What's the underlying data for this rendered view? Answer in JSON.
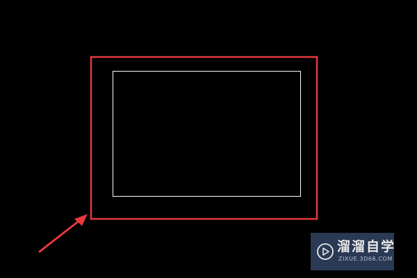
{
  "colors": {
    "background": "#000000",
    "highlight": "#e8383c",
    "shape_stroke": "#ffffff",
    "watermark_bg": "#2e3e5c"
  },
  "drawing": {
    "shape": "rectangle",
    "highlight": "red-frame",
    "annotation": "red-arrow"
  },
  "watermark": {
    "title": "溜溜自学",
    "url": "ZIXUE.3D66.COM",
    "icon": "play-logo-icon"
  }
}
